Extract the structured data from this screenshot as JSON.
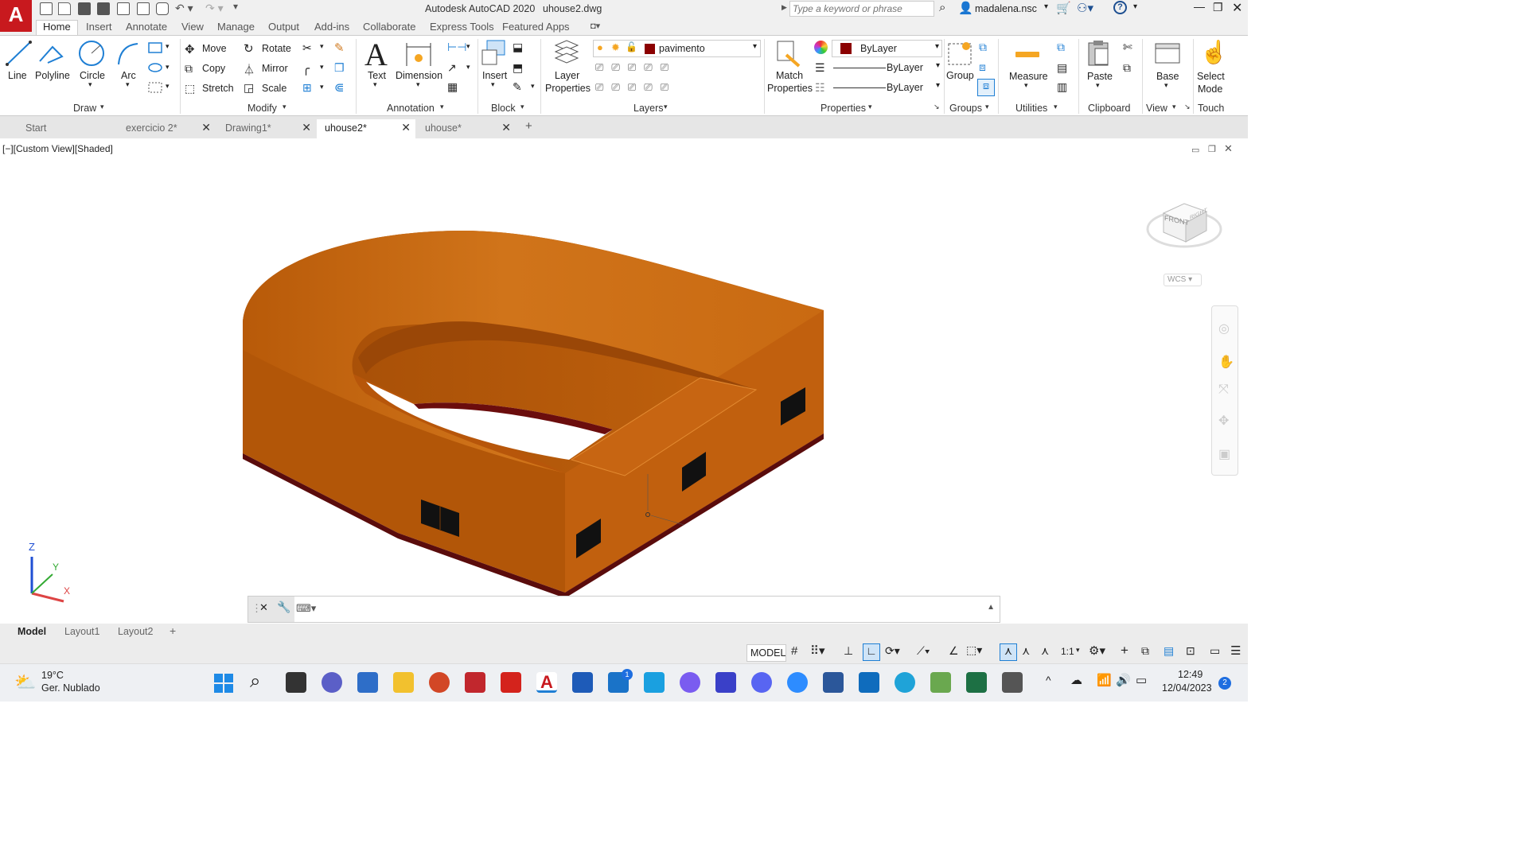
{
  "app": {
    "logo_letter": "A",
    "title": "Autodesk AutoCAD 2020",
    "filename": "uhouse2.dwg"
  },
  "search": {
    "placeholder": "Type a keyword or phrase"
  },
  "user": {
    "name": "madalena.nsc"
  },
  "ribbon_tabs": [
    "Home",
    "Insert",
    "Annotate",
    "View",
    "Manage",
    "Output",
    "Add-ins",
    "Collaborate",
    "Express Tools",
    "Featured Apps"
  ],
  "draw": {
    "title": "Draw",
    "line": "Line",
    "polyline": "Polyline",
    "circle": "Circle",
    "arc": "Arc"
  },
  "modify": {
    "title": "Modify",
    "move": "Move",
    "rotate": "Rotate",
    "copy": "Copy",
    "mirror": "Mirror",
    "stretch": "Stretch",
    "scale": "Scale"
  },
  "annotation": {
    "title": "Annotation",
    "text": "Text",
    "dimension": "Dimension"
  },
  "block": {
    "title": "Block",
    "insert": "Insert"
  },
  "layers": {
    "title": "Layers",
    "layer_properties_1": "Layer",
    "layer_properties_2": "Properties",
    "current_layer": "pavimento",
    "layer_color": "#8b0000"
  },
  "properties": {
    "title": "Properties",
    "match_1": "Match",
    "match_2": "Properties",
    "color": "ByLayer",
    "linetype": "ByLayer",
    "lineweight": "ByLayer",
    "color_swatch": "#8b0000"
  },
  "groups": {
    "title": "Groups",
    "group": "Group"
  },
  "utilities": {
    "title": "Utilities",
    "measure": "Measure"
  },
  "clipboard": {
    "title": "Clipboard",
    "paste": "Paste"
  },
  "view": {
    "title": "View",
    "base": "Base"
  },
  "touch": {
    "title": "Touch",
    "select_1": "Select",
    "select_2": "Mode"
  },
  "doc_tabs": [
    {
      "label": "Start"
    },
    {
      "label": "exercicio 2*"
    },
    {
      "label": "Drawing1*"
    },
    {
      "label": "uhouse2*"
    },
    {
      "label": "uhouse*"
    }
  ],
  "viewport": {
    "label": "[−][Custom View][Shaded]",
    "viewcube_front": "FRONT",
    "viewcube_right": "RIGHT",
    "wcs": "WCS",
    "model_color": "#c8660f"
  },
  "ucs": {
    "x": "X",
    "y": "Y",
    "z": "Z"
  },
  "layout_tabs": [
    "Model",
    "Layout1",
    "Layout2"
  ],
  "status": {
    "model": "MODEL",
    "scale": "1:1"
  },
  "weather": {
    "temp": "19°C",
    "desc": "Ger. Nublado"
  },
  "clock": {
    "time": "12:49",
    "date": "12/04/2023",
    "notif": "2"
  },
  "mail_badge": "1"
}
